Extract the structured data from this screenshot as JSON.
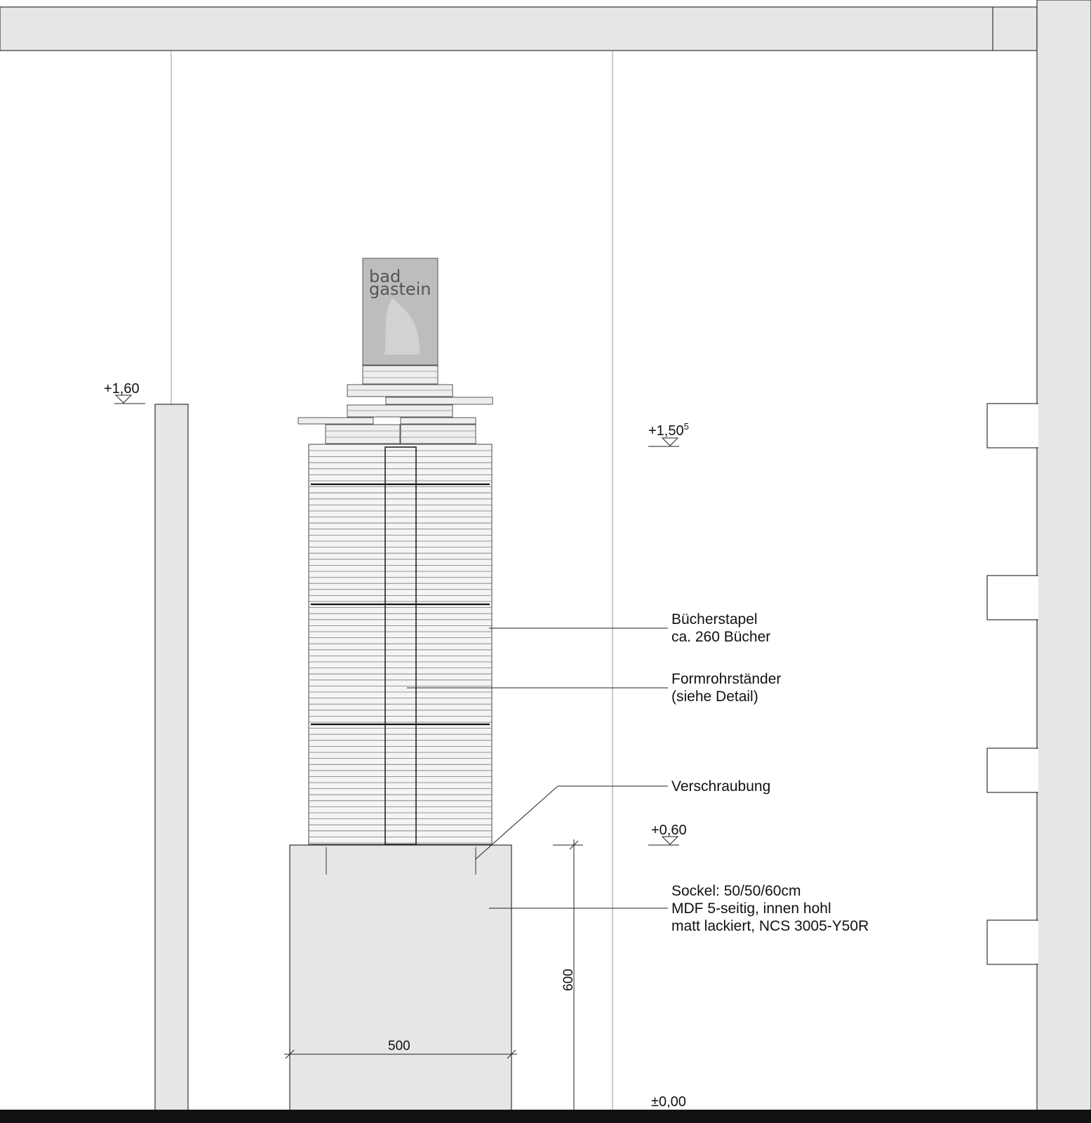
{
  "levels": {
    "top_left": "+1,60",
    "top_right_base": "+1,50",
    "top_right_sup": "5",
    "mid": "+0,60",
    "zero": "±0,00"
  },
  "annotations": {
    "books_line1": "Bücherstapel",
    "books_line2": "ca. 260 Bücher",
    "stand_line1": "Formrohrständer",
    "stand_line2": "(siehe Detail)",
    "screw": "Verschraubung",
    "base_line1": "Sockel: 50/50/60cm",
    "base_line2": "MDF 5-seitig, innen hohl",
    "base_line3": "matt lackiert, NCS 3005-Y50R"
  },
  "dimensions": {
    "height": "600",
    "width": "500"
  },
  "book_cover": {
    "line1": "bad",
    "line2": "gastein"
  },
  "colors": {
    "fill_grey": "#e6e6e6",
    "cover_grey": "#bdbdbd",
    "floor": "#111111"
  }
}
